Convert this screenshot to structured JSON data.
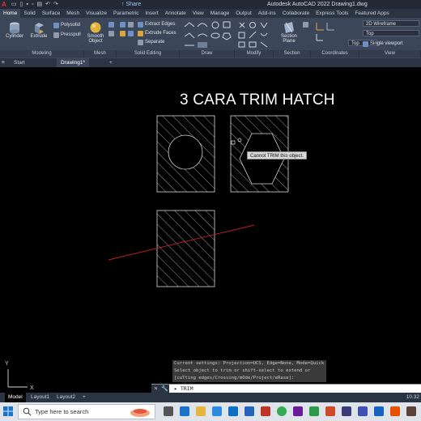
{
  "app": {
    "title": "Autodesk AutoCAD 2022   Drawing1.dwg",
    "logo": "A",
    "share_label": "Share"
  },
  "ribbon_tabs": [
    "Home",
    "Solid",
    "Surface",
    "Mesh",
    "Visualize",
    "Parametric",
    "Insert",
    "Annotate",
    "View",
    "Manage",
    "Output",
    "Add-ins",
    "Collaborate",
    "Express Tools",
    "Featured Apps"
  ],
  "ribbon": {
    "cylinder": "Cylinder",
    "extrude": "Extrude",
    "polysolid": "Polysolid",
    "presspull": "Presspull",
    "smooth_object": "Smooth Object",
    "extract_edges": "Extract Edges",
    "extrude_faces": "Extrude Faces",
    "separate": "Separate",
    "section_plane": "Section Plane",
    "visual_style": "2D Wireframe",
    "view_name": "Top",
    "coord_view": "Top",
    "viewport": "Single viewport",
    "panels": {
      "modeling": "Modeling",
      "mesh": "Mesh",
      "solid_editing": "Solid Editing",
      "draw": "Draw",
      "modify": "Modify",
      "section": "Section",
      "coordinates": "Coordinates",
      "view": "View"
    }
  },
  "doc_tabs": {
    "start": "Start",
    "drawing": "Drawing1*",
    "add": "+"
  },
  "drawing": {
    "title_text": "3 CARA TRIM HATCH",
    "tooltip": "Cannot TRIM this object."
  },
  "command": {
    "history": [
      "Current settings: Projection=UCS, Edge=None, Mode=Quick",
      "Select object to trim or shift-select to extend or",
      "[cuTting edges/Crossing/mOde/Project/eRase]:"
    ],
    "current": "TRIM",
    "close_icon": "×",
    "wrench_icon": "🔧"
  },
  "status": {
    "tabs": [
      "Model",
      "Layout1",
      "Layout2"
    ],
    "add": "+",
    "right_value": "10.32"
  },
  "taskbar": {
    "search_placeholder": "Type here to search"
  },
  "colors": {
    "ribbon_bg": "#3b4658",
    "hatch_line": "#d8d8d8",
    "trim_line": "#c0202a",
    "hexagon": "#d8d8d8"
  }
}
